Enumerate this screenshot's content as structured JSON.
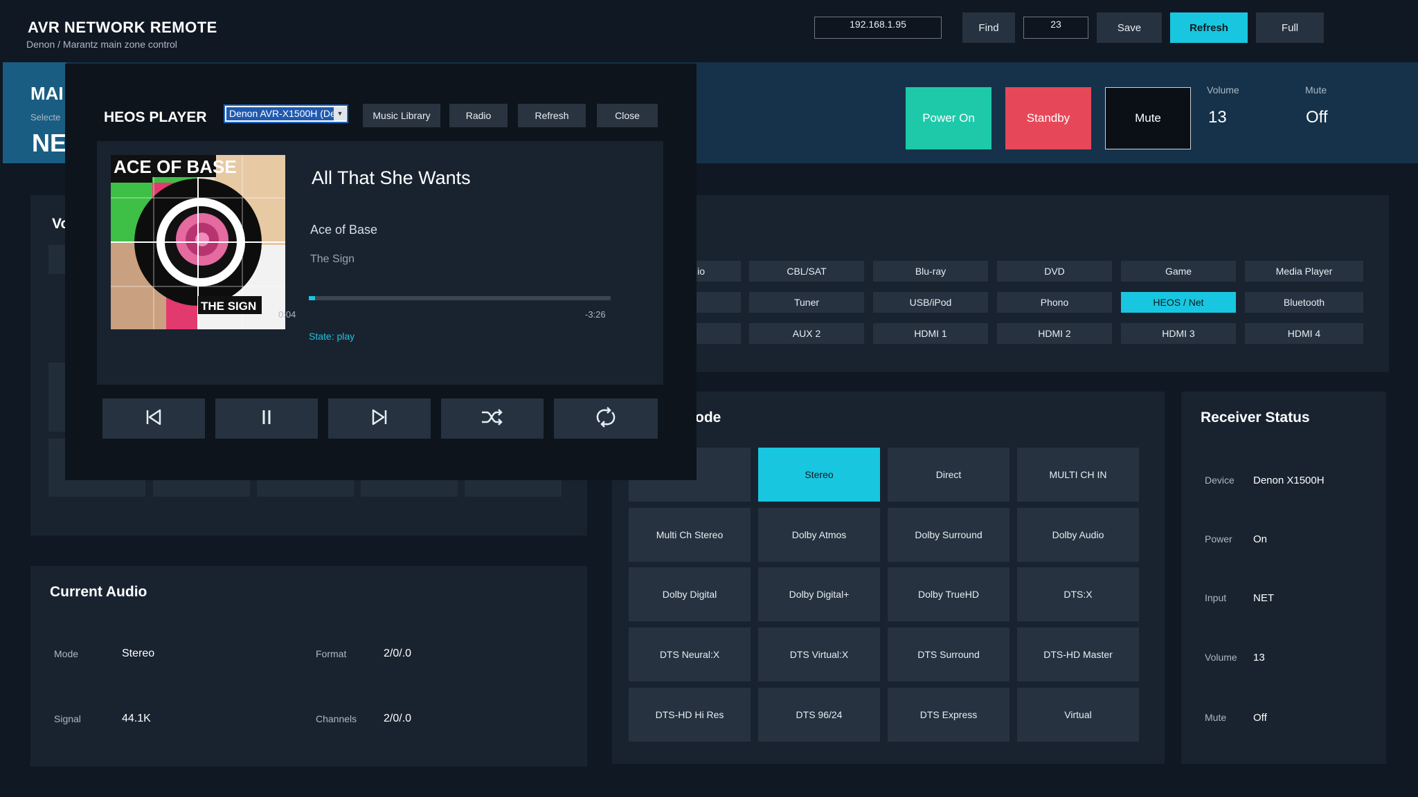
{
  "header": {
    "title": "AVR NETWORK REMOTE",
    "subtitle": "Denon / Marantz main zone control",
    "ip_value": "192.168.1.95",
    "port_value": "23",
    "find_label": "Find",
    "save_label": "Save",
    "refresh_label": "Refresh",
    "full_label": "Full"
  },
  "zone": {
    "title": "MAI",
    "selected_label": "Selecte",
    "input_value": "NE",
    "power_on_label": "Power On",
    "standby_label": "Standby",
    "mute_label": "Mute",
    "volume_label": "Volume",
    "volume_value": "13",
    "mute_state_label": "Mute",
    "mute_state_value": "Off"
  },
  "volume_panel": {
    "title_partial": "Vo"
  },
  "sources": {
    "rows": [
      [
        "io",
        "CBL/SAT",
        "Blu-ray",
        "DVD",
        "Game",
        "Media Player"
      ],
      [
        "",
        "Tuner",
        "USB/iPod",
        "Phono",
        "HEOS / Net",
        "Bluetooth"
      ],
      [
        "",
        "AUX 2",
        "HDMI 1",
        "HDMI 2",
        "HDMI 3",
        "HDMI 4"
      ]
    ],
    "active": "HEOS / Net"
  },
  "surround": {
    "title_partial": "ode",
    "rows": [
      [
        "o",
        "Stereo",
        "Direct",
        "MULTI CH IN"
      ],
      [
        "Multi Ch Stereo",
        "Dolby Atmos",
        "Dolby Surround",
        "Dolby Audio"
      ],
      [
        "Dolby Digital",
        "Dolby Digital+",
        "Dolby TrueHD",
        "DTS:X"
      ],
      [
        "DTS Neural:X",
        "DTS Virtual:X",
        "DTS Surround",
        "DTS-HD Master"
      ],
      [
        "DTS-HD Hi Res",
        "DTS 96/24",
        "DTS Express",
        "Virtual"
      ]
    ],
    "active": "Stereo"
  },
  "receiver_status": {
    "title": "Receiver Status",
    "items": [
      {
        "label": "Device",
        "value": "Denon X1500H"
      },
      {
        "label": "Power",
        "value": "On"
      },
      {
        "label": "Input",
        "value": "NET"
      },
      {
        "label": "Volume",
        "value": "13"
      },
      {
        "label": "Mute",
        "value": "Off"
      }
    ]
  },
  "current_audio": {
    "title": "Current Audio",
    "mode_label": "Mode",
    "mode_value": "Stereo",
    "format_label": "Format",
    "format_value": "2/0/.0",
    "signal_label": "Signal",
    "signal_value": "44.1K",
    "channels_label": "Channels",
    "channels_value": "2/0/.0"
  },
  "heos": {
    "title": "HEOS PLAYER",
    "device_select": "Denon AVR-X1500H (Den",
    "music_library_label": "Music Library",
    "radio_label": "Radio",
    "refresh_label": "Refresh",
    "close_label": "Close",
    "track_title": "All That She Wants",
    "artist": "Ace of Base",
    "album": "The Sign",
    "album_art_text_top": "ACE OF BASE",
    "album_art_text_bottom": "THE SIGN",
    "elapsed": "0:04",
    "remaining": "-3:26",
    "progress": 0.02,
    "state": "State: play",
    "controls": [
      "previous-icon",
      "pause-icon",
      "next-icon",
      "shuffle-icon",
      "repeat-icon"
    ]
  },
  "colors": {
    "accent": "#19c6e0",
    "power_on": "#1ec9a9",
    "standby": "#e6485a",
    "mute": "#0b1016",
    "background": "#101824"
  }
}
